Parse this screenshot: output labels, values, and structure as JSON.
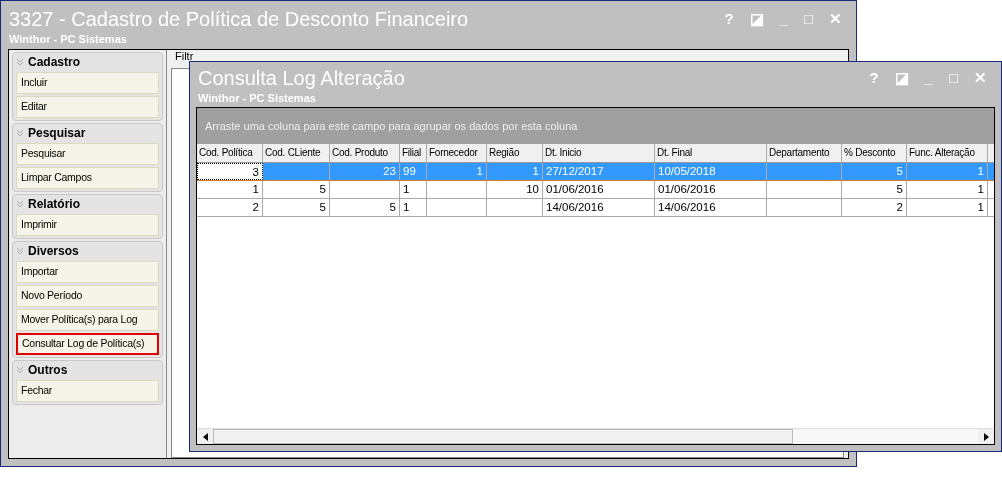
{
  "main_window": {
    "title": "3327 - Cadastro de Política de Desconto Financeiro",
    "subtitle": "Winthor - PC Sistemas",
    "title_buttons": [
      "?",
      "◪",
      "_",
      "□",
      "✕"
    ],
    "sidebar": [
      {
        "title": "Cadastro",
        "items": [
          {
            "label": "Incluir",
            "selected": false
          },
          {
            "label": "Editar",
            "selected": false
          }
        ]
      },
      {
        "title": "Pesquisar",
        "items": [
          {
            "label": "Pesquisar",
            "selected": false
          },
          {
            "label": "Limpar Campos",
            "selected": false
          }
        ]
      },
      {
        "title": "Relatório",
        "items": [
          {
            "label": "Imprimir",
            "selected": false
          }
        ]
      },
      {
        "title": "Diversos",
        "items": [
          {
            "label": "Importar",
            "selected": false
          },
          {
            "label": "Novo Período",
            "selected": false
          },
          {
            "label": "Mover Política(s) para Log",
            "selected": false
          },
          {
            "label": "Consultar Log de Política(s)",
            "selected": true
          }
        ]
      },
      {
        "title": "Outros",
        "items": [
          {
            "label": "Fechar",
            "selected": false
          }
        ]
      }
    ],
    "tabs": [
      {
        "label": "Filtr",
        "selected": false
      }
    ]
  },
  "log_window": {
    "title": "Consulta Log Alteração",
    "subtitle": "Winthor - PC Sistemas",
    "title_buttons": [
      "?",
      "◪",
      "_",
      "□",
      "✕"
    ],
    "group_hint": "Arraste uma coluna para este campo para agrupar os dados por esta coluna",
    "table": {
      "columns": [
        {
          "label": "Cod. Política"
        },
        {
          "label": "Cod. CLiente"
        },
        {
          "label": "Cod. Produto"
        },
        {
          "label": "Filial"
        },
        {
          "label": "Fornecedor"
        },
        {
          "label": "Região"
        },
        {
          "label": "Dt. Inicio"
        },
        {
          "label": "Dt. Final"
        },
        {
          "label": "Departamento"
        },
        {
          "label": "% Desconto"
        },
        {
          "label": "Func. Alteração"
        }
      ],
      "rows": [
        {
          "selected": true,
          "cells": [
            "3",
            "",
            "23",
            "99",
            "1",
            "1",
            "27/12/2017",
            "10/05/2018",
            "",
            "5",
            "1"
          ]
        },
        {
          "selected": false,
          "cells": [
            "1",
            "5",
            "",
            "1",
            "",
            "10",
            "01/06/2016",
            "01/06/2016",
            "",
            "5",
            "1"
          ]
        },
        {
          "selected": false,
          "cells": [
            "2",
            "5",
            "5",
            "1",
            "",
            "",
            "14/06/2016",
            "14/06/2016",
            "",
            "2",
            "1"
          ]
        }
      ]
    }
  }
}
